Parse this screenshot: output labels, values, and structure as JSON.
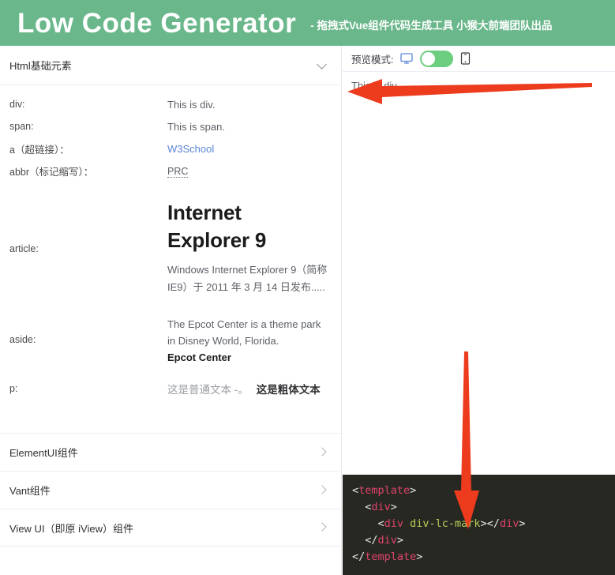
{
  "banner": {
    "title": "Low Code Generator",
    "subtitle": "- 拖拽式Vue组件代码生成工具 小猴大前端团队出品",
    "bg_color": "#69b78a"
  },
  "left_panel": {
    "collapse_header": {
      "title": "Html基础元素",
      "chevron": "chevron-down-icon"
    },
    "rows": [
      {
        "label": "div:",
        "value": "This is div."
      },
      {
        "label": "span:",
        "value": "This is span."
      },
      {
        "label": "a（超链接）：",
        "value": "W3School",
        "link_color": "#5b87d6"
      },
      {
        "label": "abbr（标记缩写）：",
        "value": "PRC"
      }
    ],
    "article": {
      "label": "article:",
      "heading_line1": "Internet",
      "heading_line2": "Explorer 9",
      "paragraph": "Windows Internet Explorer 9（简称 IE9）于 2011 年 3 月 14 日发布....."
    },
    "aside": {
      "label": "aside:",
      "paragraph": "The Epcot Center is a theme park in Disney World, Florida.",
      "strong": "Epcot Center"
    },
    "p_row": {
      "label": "p:",
      "normal_text": "这是普通文本 -。",
      "bold_text": "这是粗体文本"
    },
    "list_items": [
      {
        "label": "ElementUI组件",
        "chevron": "chevron-right-icon"
      },
      {
        "label": "Vant组件",
        "chevron": "chevron-right-icon"
      },
      {
        "label": "View UI（即原 iView）组件",
        "chevron": "chevron-right-icon"
      }
    ]
  },
  "right_panel": {
    "mode_bar": {
      "label": "预览模式:",
      "desktop_icon": "desktop-monitor-icon",
      "mobile_icon": "mobile-phone-icon",
      "switch_state": "on",
      "switch_color": "#6cce7f"
    },
    "preview": {
      "text": "This is div."
    },
    "code": {
      "background": "#272822",
      "lines": [
        [
          {
            "t": "<",
            "c": "punc"
          },
          {
            "t": "template",
            "c": "tag"
          },
          {
            "t": ">",
            "c": "punc"
          }
        ],
        [
          {
            "t": "  <",
            "c": "punc"
          },
          {
            "t": "div",
            "c": "tag"
          },
          {
            "t": ">",
            "c": "punc"
          }
        ],
        [
          {
            "t": "    <",
            "c": "punc"
          },
          {
            "t": "div",
            "c": "tag"
          },
          {
            "t": " div-lc-mark",
            "c": "attr"
          },
          {
            "t": "></",
            "c": "punc"
          },
          {
            "t": "div",
            "c": "tag"
          },
          {
            "t": ">",
            "c": "punc"
          }
        ],
        [
          {
            "t": "  </",
            "c": "punc"
          },
          {
            "t": "div",
            "c": "tag"
          },
          {
            "t": ">",
            "c": "punc"
          }
        ],
        [
          {
            "t": "</",
            "c": "punc"
          },
          {
            "t": "template",
            "c": "tag"
          },
          {
            "t": ">",
            "c": "punc"
          }
        ]
      ]
    }
  },
  "annotations": {
    "color": "#ec3b1d",
    "arrows": [
      {
        "name": "arrow-pointing-to-preview-text",
        "direction": "left"
      },
      {
        "name": "arrow-pointing-to-code-mark",
        "direction": "down"
      }
    ]
  }
}
